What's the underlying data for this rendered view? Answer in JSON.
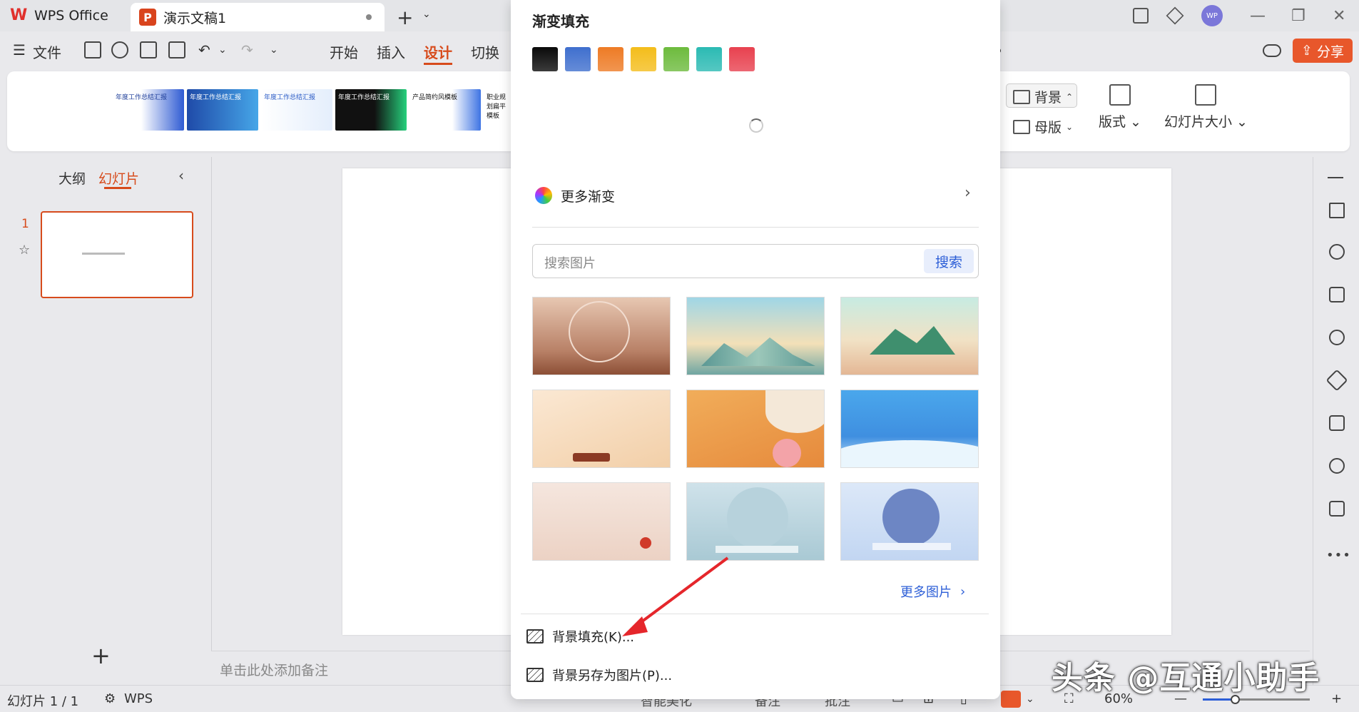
{
  "titlebar": {
    "app_name": "WPS Office",
    "doc_tab": "演示文稿1",
    "avatar": "WP"
  },
  "menubar": {
    "file": "文件",
    "tabs": [
      "开始",
      "插入",
      "设计",
      "切换"
    ],
    "active_tab": "设计",
    "share": "分享"
  },
  "ribbon": {
    "template_texts": [
      "年度工作总结汇报",
      "年度工作总结汇报",
      "年度工作总结汇报",
      "年度工作总结汇报",
      "产品简约风模板",
      "职业规划扁平模板"
    ],
    "background": "背景",
    "master": "母版",
    "layout": "版式",
    "slide_size": "幻灯片大小"
  },
  "left_panel": {
    "outline_tab": "大纲",
    "slides_tab": "幻灯片",
    "slide_number": "1"
  },
  "notes_placeholder": "单击此处添加备注",
  "statusbar": {
    "slide_info": "幻灯片 1 / 1",
    "wps": "WPS",
    "smart_beautify": "智能美化",
    "notes": "备注",
    "comments": "批注",
    "zoom": "60%",
    "zoom_fraction": 0.3
  },
  "popup": {
    "title": "渐变填充",
    "gradient_colors": [
      "#0a0a0a",
      "#3f6fce",
      "#ee7b25",
      "#f4bd1b",
      "#6dbb3d",
      "#2bbab3",
      "#e8414f"
    ],
    "more_gradients": "更多渐变",
    "search_placeholder": "搜索图片",
    "search_button": "搜索",
    "more_pictures": "更多图片",
    "bg_fill": "背景填充(K)...",
    "bg_save_as_image": "背景另存为图片(P)..."
  },
  "watermark": "头条 @互通小助手"
}
